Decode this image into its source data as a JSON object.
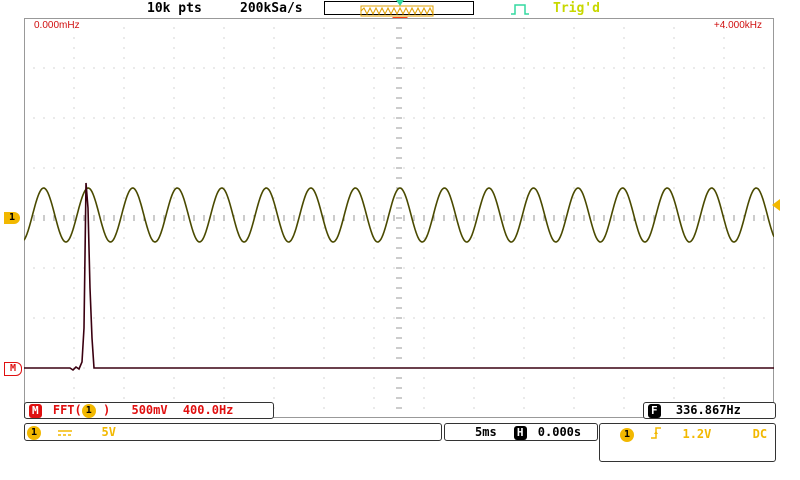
{
  "header": {
    "points": "10k pts",
    "sample_rate": "200kSa/s",
    "trigger_status": "Trig'd"
  },
  "screen": {
    "freq_start": "0.000mHz",
    "freq_end": "+4.000kHz"
  },
  "markers": {
    "ch1": "1",
    "math": "M"
  },
  "math_bar": {
    "tag": "M",
    "function": "FFT(",
    "source": "1",
    "close": ")",
    "scale": "500mV",
    "freq_scale": "400.0Hz"
  },
  "freq_counter": {
    "tag": "F",
    "value": "336.867Hz"
  },
  "ch1_bar": {
    "channel": "1",
    "coupling_icon": "dc-coupling-icon",
    "volts_div": "5V"
  },
  "time_bar": {
    "time_div": "5ms",
    "pos_tag": "H",
    "delay": "0.000s"
  },
  "trigger_bar": {
    "channel": "1",
    "edge_icon": "rising-edge-icon",
    "level": "1.2V",
    "coupling": "DC"
  },
  "colors": {
    "ch1": "#f2b800",
    "trace": "#4a4a00",
    "math": "#e01010",
    "fft_trace": "#3a0010",
    "trig_indicator": "#33d9a0"
  }
}
